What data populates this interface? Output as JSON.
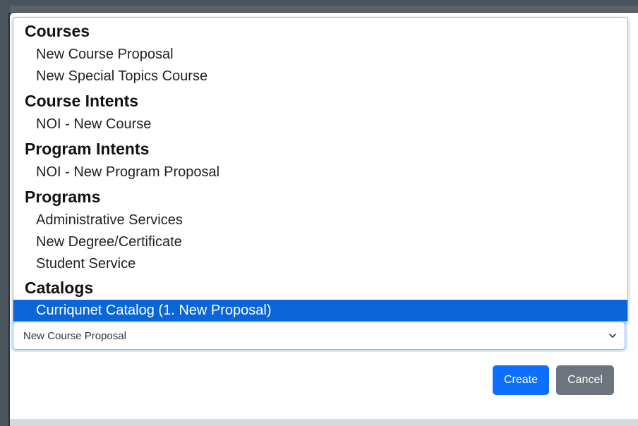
{
  "dropdown": {
    "groups": [
      {
        "label": "Courses",
        "options": [
          "New Course Proposal",
          "New Special Topics Course"
        ]
      },
      {
        "label": "Course Intents",
        "options": [
          "NOI - New Course"
        ]
      },
      {
        "label": "Program Intents",
        "options": [
          "NOI - New Program Proposal"
        ]
      },
      {
        "label": "Programs",
        "options": [
          "Administrative Services",
          "New Degree/Certificate",
          "Student Service"
        ]
      },
      {
        "label": "Catalogs",
        "options": [
          "Curriqunet Catalog (1. New Proposal)"
        ]
      }
    ],
    "highlighted_option": "Curriqunet Catalog (1. New Proposal)"
  },
  "select": {
    "value": "New Course Proposal"
  },
  "footer": {
    "create_label": "Create",
    "cancel_label": "Cancel"
  },
  "colors": {
    "highlight": "#0a66d8",
    "primary": "#0d6efd",
    "secondary": "#6c757d"
  }
}
